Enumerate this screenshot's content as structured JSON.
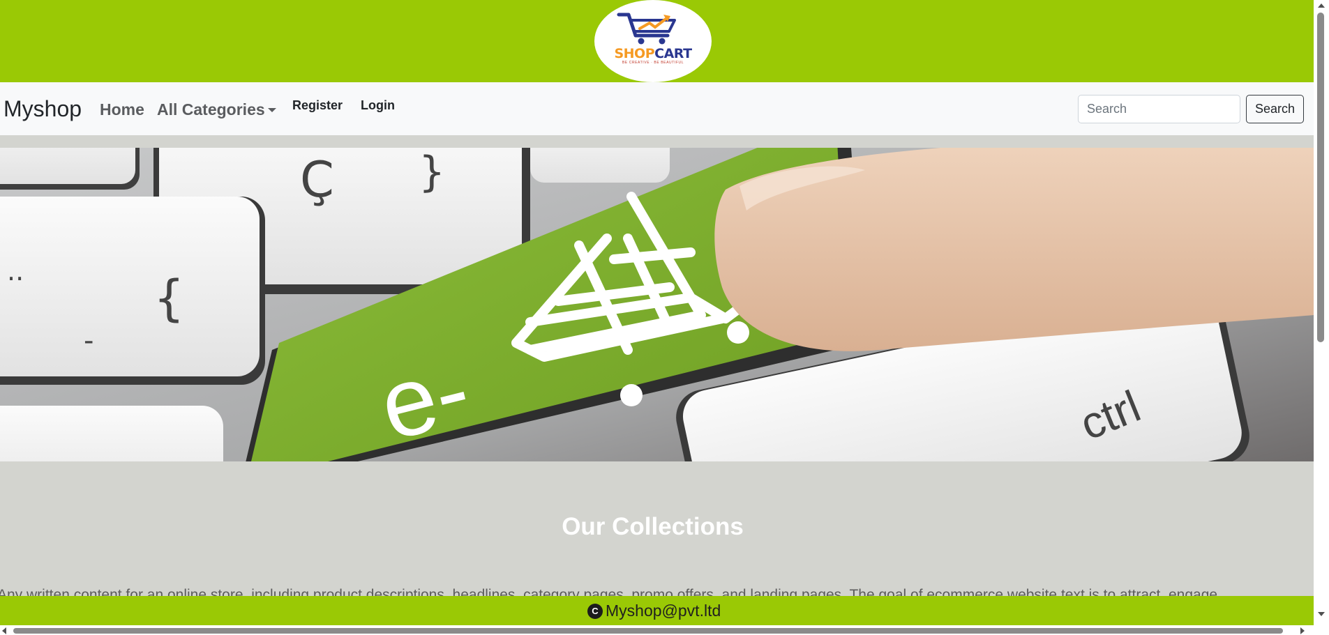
{
  "brand_colors": {
    "green": "#9ac905",
    "navbar_bg": "#f8f9fa",
    "page_bg": "#d3d4cf",
    "logo_orange": "#f59a23",
    "logo_blue": "#2a3790"
  },
  "logo": {
    "word_part1": "SHOP",
    "word_part2": "CART",
    "tagline": "BE CREATIVE · BE BEAUTIFUL",
    "icon": "shopping-cart-icon"
  },
  "navbar": {
    "brand": "Myshop",
    "home": "Home",
    "categories": "All Categories",
    "register": "Register",
    "login": "Login",
    "search_placeholder": "Search",
    "search_button": "Search"
  },
  "hero": {
    "key_text": "e-",
    "ctrl_label": "ctrl",
    "icon": "shopping-cart-icon"
  },
  "collections": {
    "title": "Our Collections",
    "text": "Any written content for an online store, including product descriptions, headlines, category pages, promo offers, and landing pages. The goal of ecommerce website text is to attract, engage"
  },
  "footer": {
    "copyright_symbol": "C",
    "text": "Myshop@pvt.ltd"
  }
}
